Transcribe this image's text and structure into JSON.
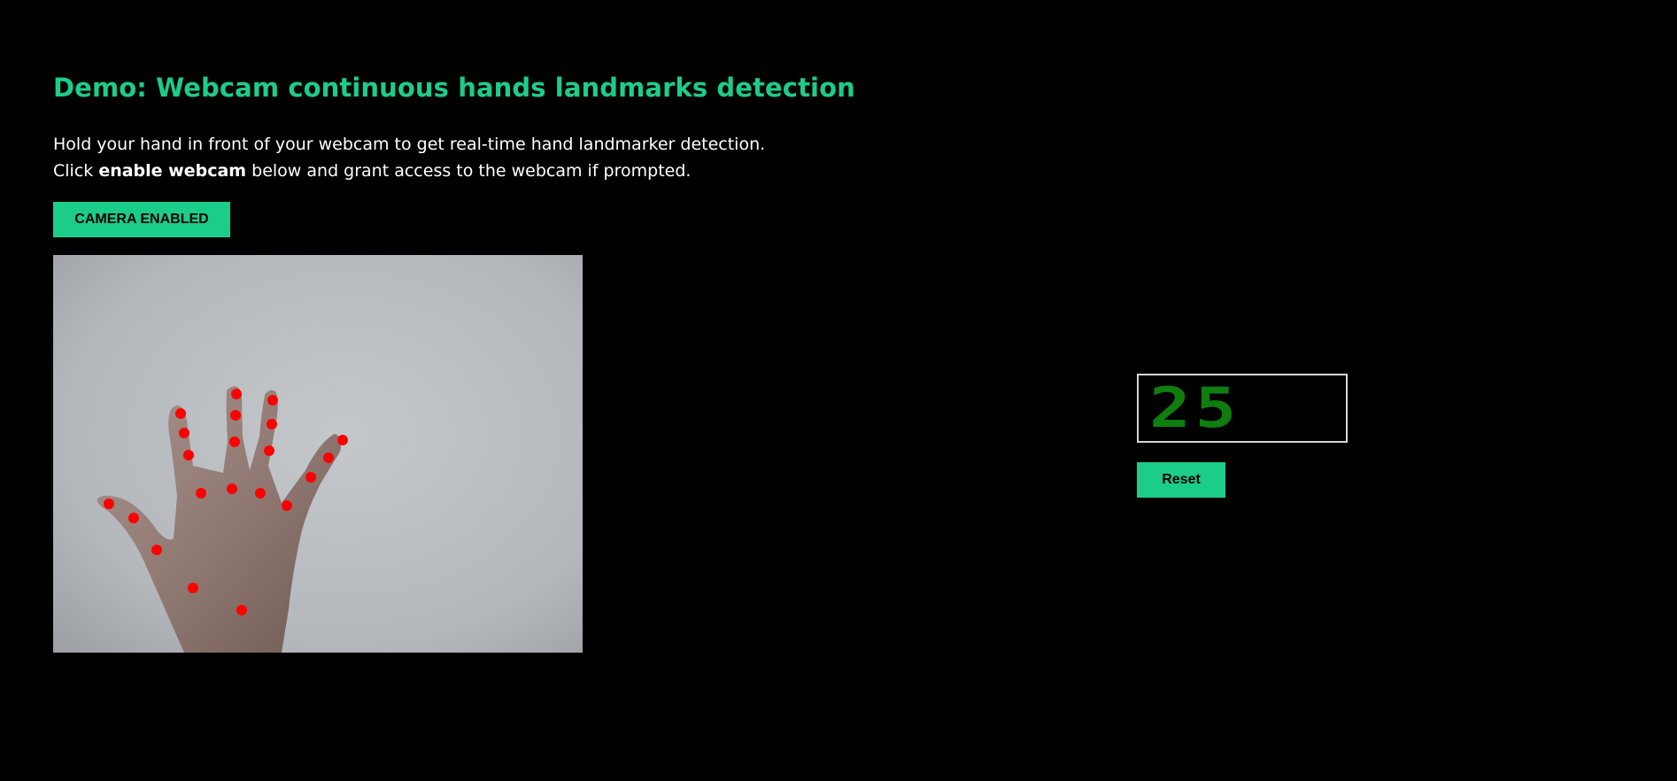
{
  "page": {
    "title": "Demo: Webcam continuous hands landmarks detection",
    "description": {
      "line1": "Hold your hand in front of your webcam to get real-time hand landmarker detection.",
      "line2_prefix": "Click ",
      "line2_bold": "enable webcam",
      "line2_suffix": " below and grant access to the webcam if prompted."
    },
    "camera_button_label": "CAMERA ENABLED"
  },
  "counter": {
    "value": "25",
    "reset_label": "Reset"
  },
  "colors": {
    "accent": "#1ccd8a",
    "landmark": "#ff0000",
    "counter_text": "#0f7e0f"
  }
}
